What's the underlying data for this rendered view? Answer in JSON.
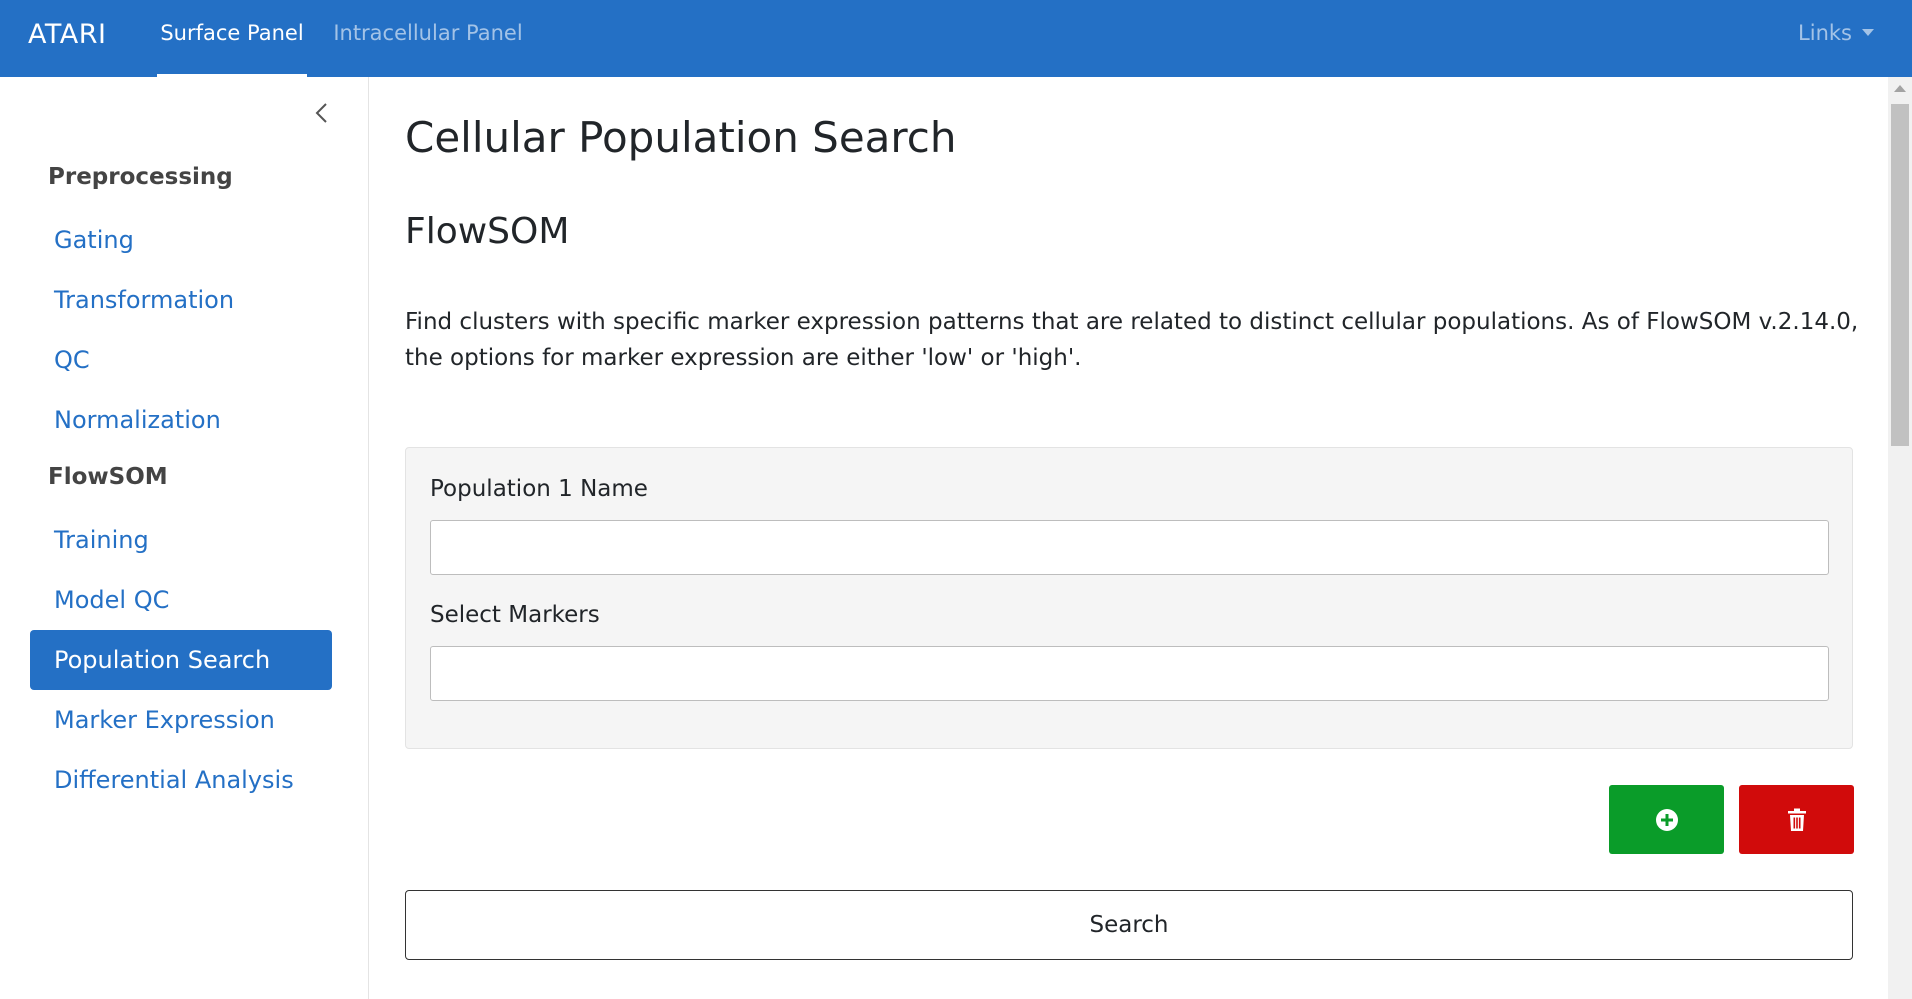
{
  "navbar": {
    "brand": "ATARI",
    "tabs": [
      {
        "label": "Surface Panel",
        "active": true
      },
      {
        "label": "Intracellular Panel",
        "active": false
      }
    ],
    "links_label": "Links",
    "background_color": "#2470c5"
  },
  "sidebar": {
    "collapse_icon": "chevron-left-icon",
    "sections": [
      {
        "title": "Preprocessing",
        "items": [
          {
            "label": "Gating",
            "active": false
          },
          {
            "label": "Transformation",
            "active": false
          },
          {
            "label": "QC",
            "active": false
          },
          {
            "label": "Normalization",
            "active": false
          }
        ]
      },
      {
        "title": "FlowSOM",
        "items": [
          {
            "label": "Training",
            "active": false
          },
          {
            "label": "Model QC",
            "active": false
          },
          {
            "label": "Population Search",
            "active": true
          },
          {
            "label": "Marker Expression",
            "active": false
          },
          {
            "label": "Differential Analysis",
            "active": false
          }
        ]
      }
    ]
  },
  "main": {
    "page_title": "Cellular Population Search",
    "section_title": "FlowSOM",
    "description": "Find clusters with specific marker expression patterns that are related to distinct cellular populations. As of FlowSOM v.2.14.0, the options for marker expression are either 'low' or 'high'.",
    "population_form": {
      "name_label": "Population 1 Name",
      "name_value": "",
      "markers_label": "Select Markers",
      "markers_value": ""
    },
    "add_button": {
      "icon": "plus-circle-icon",
      "color": "#0a9c29"
    },
    "delete_button": {
      "icon": "trash-icon",
      "color": "#d10b0b"
    },
    "search_label": "Search"
  }
}
